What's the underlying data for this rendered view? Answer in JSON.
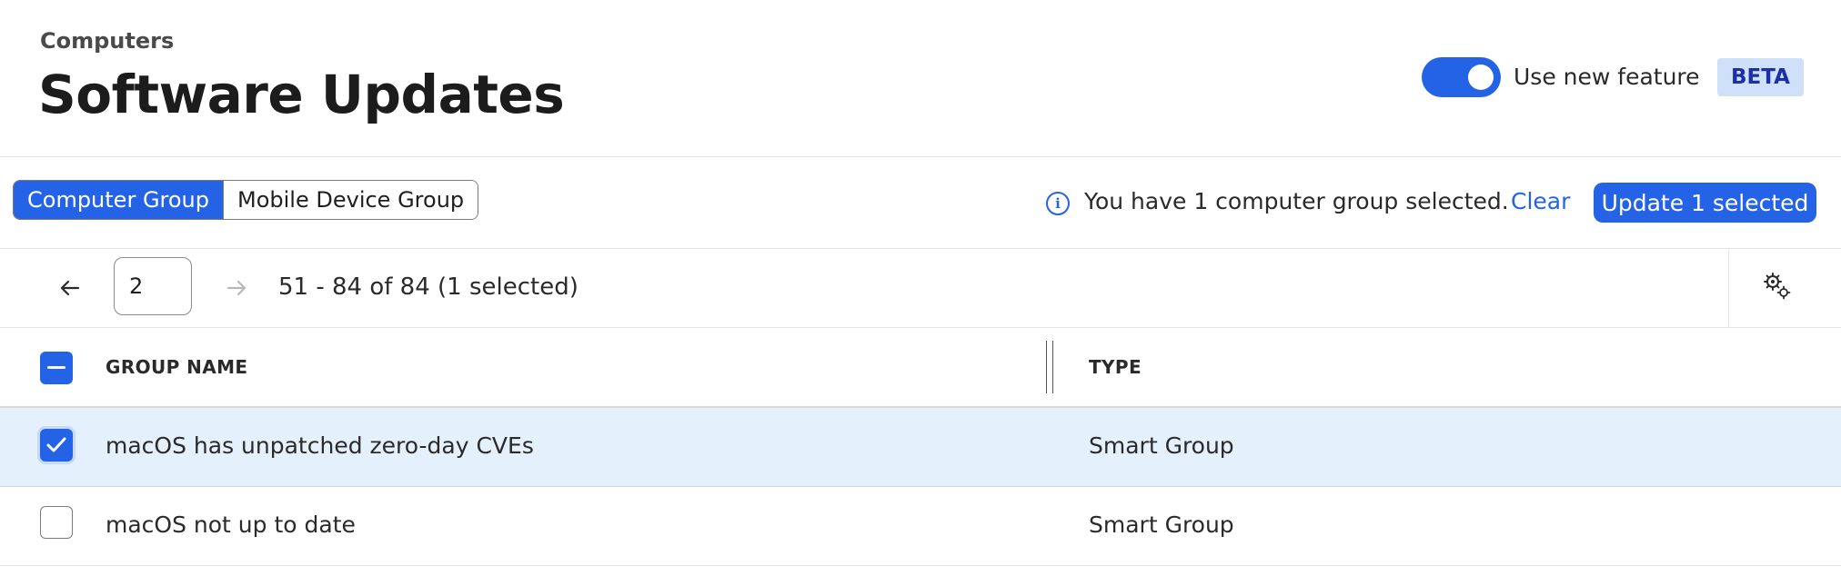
{
  "header": {
    "breadcrumb": "Computers",
    "title": "Software Updates",
    "toggle_label": "Use new feature",
    "toggle_on": true,
    "beta_badge": "BETA"
  },
  "toolbar": {
    "segments": [
      {
        "label": "Computer Group",
        "active": true
      },
      {
        "label": "Mobile Device Group",
        "active": false
      }
    ],
    "info_text": "You have 1 computer group selected.",
    "clear_label": "Clear",
    "update_label": "Update 1 selected"
  },
  "pagination": {
    "page": "2",
    "range_text": "51 - 84 of 84 (1 selected)"
  },
  "table": {
    "columns": [
      "GROUP NAME",
      "TYPE"
    ],
    "rows": [
      {
        "name": "macOS has unpatched zero-day CVEs",
        "type": "Smart Group",
        "selected": true
      },
      {
        "name": "macOS not up to date",
        "type": "Smart Group",
        "selected": false
      }
    ]
  },
  "colors": {
    "accent": "#2563e6",
    "selected_row": "#e4f0fc",
    "beta_bg": "#cfe0fb",
    "beta_text": "#1b2fa6"
  },
  "icons": [
    "info-icon",
    "arrow-left-icon",
    "arrow-right-icon",
    "settings-gears-icon",
    "checkmark-icon",
    "minus-icon"
  ]
}
